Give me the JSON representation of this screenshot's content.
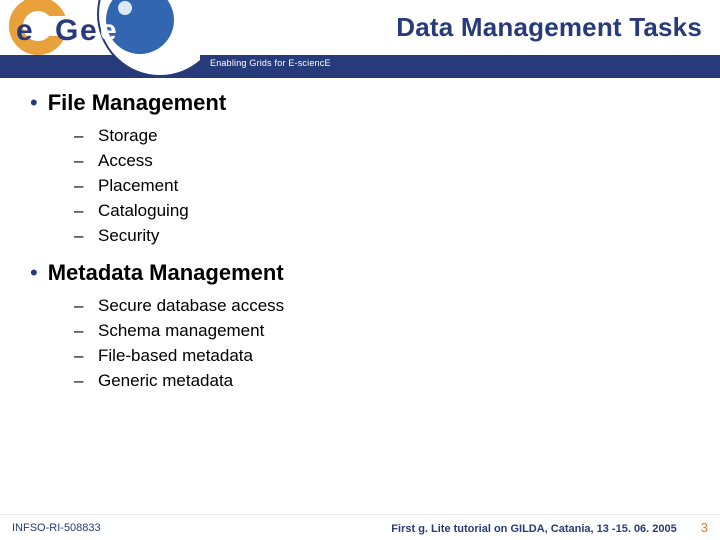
{
  "header": {
    "title": "Data Management Tasks",
    "tagline": "Enabling Grids for E-sciencE",
    "logo_text": "egee"
  },
  "content": {
    "sections": [
      {
        "title": "File Management",
        "items": [
          "Storage",
          "Access",
          "Placement",
          "Cataloguing",
          "Security"
        ]
      },
      {
        "title": "Metadata Management",
        "items": [
          "Secure database access",
          "Schema management",
          "File-based metadata",
          "Generic metadata"
        ]
      }
    ]
  },
  "footer": {
    "left": "INFSO-RI-508833",
    "center": "First g. Lite tutorial on GILDA, Catania, 13 -15. 06. 2005",
    "page": "3"
  },
  "colors": {
    "brand_blue": "#273b7a",
    "accent_orange": "#e17a2d"
  }
}
